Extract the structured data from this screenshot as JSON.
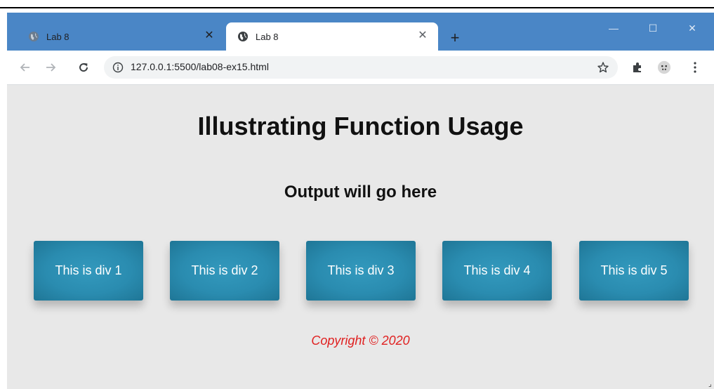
{
  "browser": {
    "tabs": [
      {
        "title": "Lab 8",
        "active": false,
        "favicon": "globe-icon"
      },
      {
        "title": "Lab 8",
        "active": true,
        "favicon": "globe-icon"
      }
    ],
    "new_tab_icon": "plus-icon",
    "window_controls": {
      "minimize": "—",
      "maximize": "☐",
      "close": "✕"
    },
    "url": "127.0.0.1:5500/lab08-ex15.html",
    "toolbar_icons": [
      "back-icon",
      "forward-icon",
      "reload-icon",
      "info-icon",
      "star-icon",
      "extensions-icon",
      "profile-icon",
      "menu-icon"
    ],
    "tab_strip_color": "#4a86c6"
  },
  "page": {
    "title": "Illustrating Function Usage",
    "output_text": "Output will go here",
    "divs": [
      "This is div 1",
      "This is div 2",
      "This is div 3",
      "This is div 4",
      "This is div 5"
    ],
    "box_color": "#2a8cb0",
    "background_color": "#e8e8e8",
    "copyright": "Copyright © 2020",
    "copyright_color": "#e02020"
  }
}
